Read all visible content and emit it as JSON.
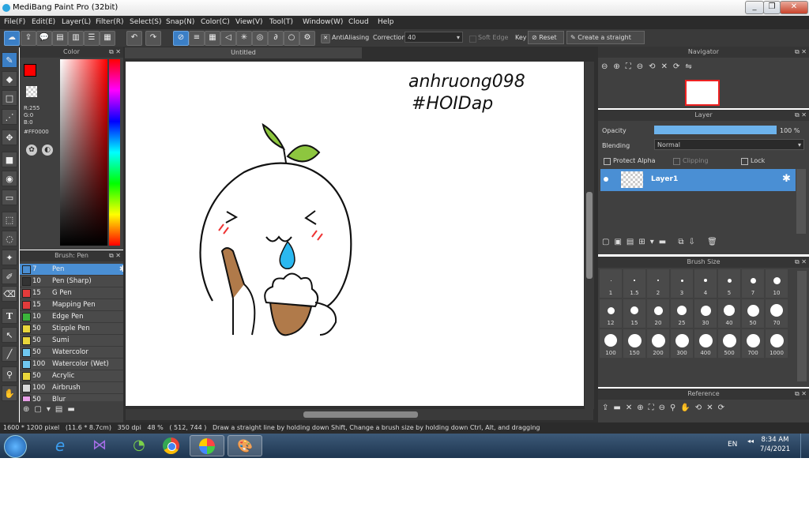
{
  "window": {
    "title": "MediBang Paint Pro (32bit)",
    "minimize": "_",
    "maximize": "❐",
    "close": "✕"
  },
  "menu": [
    "File(F)",
    "Edit(E)",
    "Layer(L)",
    "Filter(R)",
    "Select(S)",
    "Snap(N)",
    "Color(C)",
    "View(V)",
    "Tool(T)",
    "Window(W)",
    "Cloud",
    "Help"
  ],
  "toolbar": {
    "antialiasing_label": "AntiAliasing",
    "correction_label": "Correction",
    "correction_value": "40",
    "soft_edge_label": "Soft Edge",
    "key_label": "Key",
    "reset_label": "Reset",
    "straight_line_label": "Create a straight line"
  },
  "color_panel": {
    "title": "Color",
    "r": "R:255",
    "g": "G:0",
    "b": "B:0",
    "hex": "#FF0000",
    "primary": "#ff0000"
  },
  "brush_panel": {
    "title": "Brush: Pen",
    "brushes": [
      {
        "size": "7",
        "name": "Pen",
        "color": "#4a8fd4"
      },
      {
        "size": "10",
        "name": "Pen (Sharp)",
        "color": "#333333"
      },
      {
        "size": "15",
        "name": "G Pen",
        "color": "#e33b3b"
      },
      {
        "size": "15",
        "name": "Mapping Pen",
        "color": "#e33b3b"
      },
      {
        "size": "10",
        "name": "Edge Pen",
        "color": "#3bb53b"
      },
      {
        "size": "50",
        "name": "Stipple Pen",
        "color": "#e8d63b"
      },
      {
        "size": "50",
        "name": "Sumi",
        "color": "#e8d63b"
      },
      {
        "size": "50",
        "name": "Watercolor",
        "color": "#6fc8f0"
      },
      {
        "size": "100",
        "name": "Watercolor (Wet)",
        "color": "#6fc8f0"
      },
      {
        "size": "50",
        "name": "Acrylic",
        "color": "#e8d63b"
      },
      {
        "size": "100",
        "name": "Airbrush",
        "color": "#d8d8d8"
      },
      {
        "size": "50",
        "name": "Blur",
        "color": "#e8a0e8"
      }
    ]
  },
  "canvas": {
    "tab": "Untitled",
    "signature_line1": "anhruong098",
    "signature_line2": "#HOIDap"
  },
  "navigator": {
    "title": "Navigator"
  },
  "layer_panel": {
    "title": "Layer",
    "opacity_label": "Opacity",
    "opacity_value": "100 %",
    "opacity_fraction": 1.0,
    "blending_label": "Blending",
    "blending_value": "Normal",
    "protect_alpha": "Protect Alpha",
    "clipping": "Clipping",
    "lock": "Lock",
    "layer_name": "Layer1"
  },
  "brush_size_panel": {
    "title": "Brush Size",
    "sizes": [
      "1",
      "1.5",
      "2",
      "3",
      "4",
      "5",
      "7",
      "10",
      "12",
      "15",
      "20",
      "25",
      "30",
      "40",
      "50",
      "70",
      "100",
      "150",
      "200",
      "300",
      "400",
      "500",
      "700",
      "1000"
    ]
  },
  "reference_panel": {
    "title": "Reference"
  },
  "status": {
    "text": "1600 * 1200 pixel   (11.6 * 8.7cm)   350 dpi   48 %   ( 512, 744 )   Draw a straight line by holding down Shift, Change a brush size by holding down Ctrl, Alt, and dragging"
  },
  "taskbar": {
    "lang": "EN",
    "time": "8:34 AM",
    "date": "7/4/2021"
  }
}
